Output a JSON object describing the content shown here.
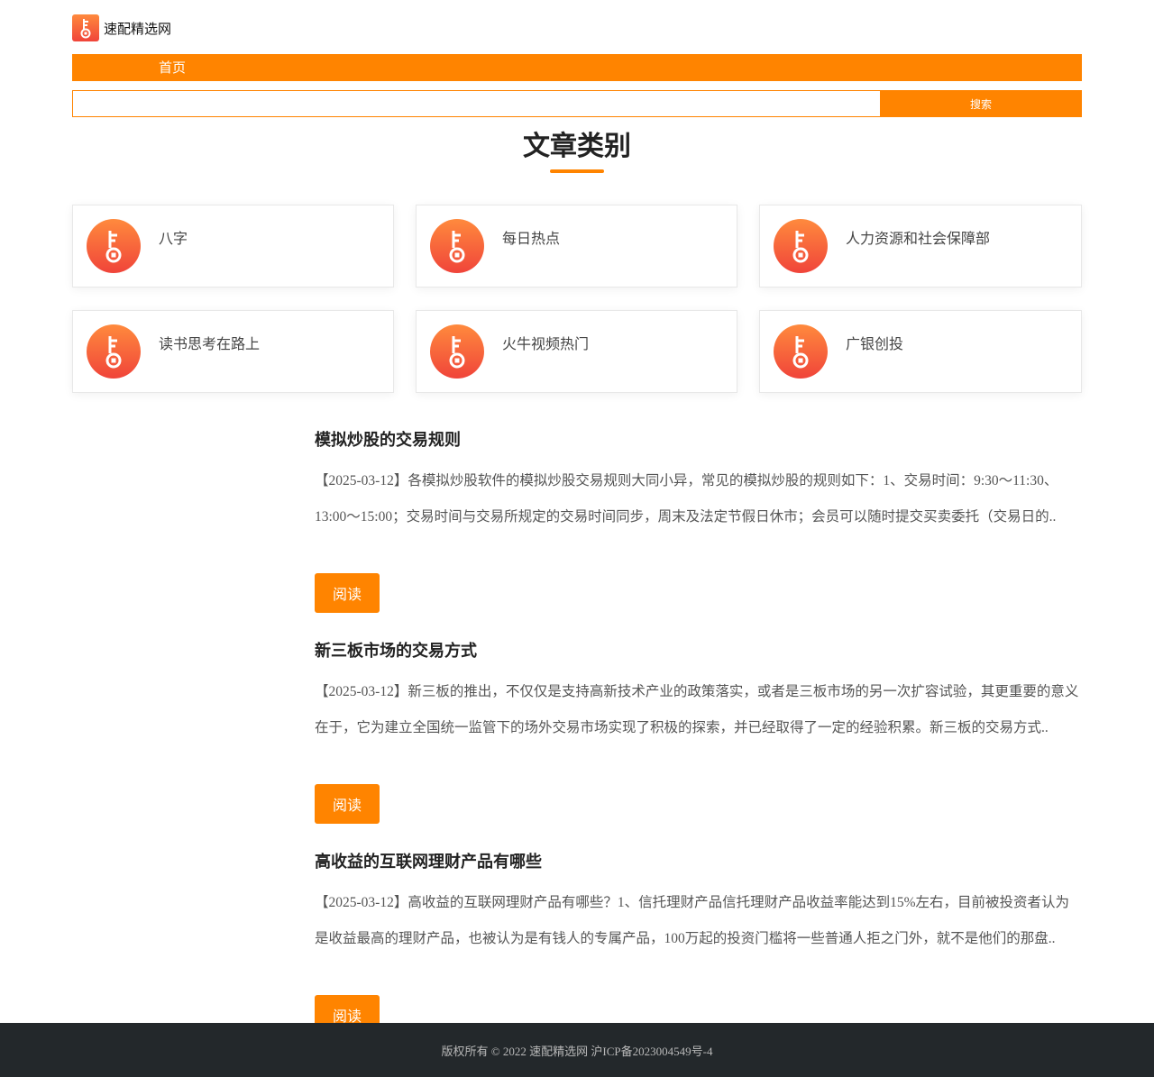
{
  "site": {
    "name": "速配精选网",
    "accent": "#ff8400"
  },
  "nav": {
    "items": [
      {
        "label": "首页"
      }
    ]
  },
  "search": {
    "placeholder": "",
    "value": "",
    "button_label": "搜索"
  },
  "categories_section": {
    "title": "文章类别",
    "items": [
      {
        "label": "八字",
        "icon": "key-icon"
      },
      {
        "label": "每日热点",
        "icon": "key-icon"
      },
      {
        "label": "人力资源和社会保障部",
        "icon": "key-icon"
      },
      {
        "label": "读书思考在路上",
        "icon": "key-icon"
      },
      {
        "label": "火牛视频热门",
        "icon": "key-icon"
      },
      {
        "label": "广银创投",
        "icon": "key-icon"
      }
    ]
  },
  "articles": [
    {
      "title": "模拟炒股的交易规则",
      "excerpt": "【2025-03-12】各模拟炒股软件的模拟炒股交易规则大同小异，常见的模拟炒股的规则如下：1、交易时间：9:30～11:30、13:00～15:00；交易时间与交易所规定的交易时间同步，周末及法定节假日休市；会员可以随时提交买卖委托（交易日的..",
      "button_label": "阅读"
    },
    {
      "title": "新三板市场的交易方式",
      "excerpt": "【2025-03-12】新三板的推出，不仅仅是支持高新技术产业的政策落实，或者是三板市场的另一次扩容试验，其更重要的意义在于，它为建立全国统一监管下的场外交易市场实现了积极的探索，并已经取得了一定的经验积累。新三板的交易方式..",
      "button_label": "阅读"
    },
    {
      "title": "高收益的互联网理财产品有哪些",
      "excerpt": "【2025-03-12】高收益的互联网理财产品有哪些？1、信托理财产品信托理财产品收益率能达到15%左右，目前被投资者认为是收益最高的理财产品，也被认为是有钱人的专属产品，100万起的投资门槛将一些普通人拒之门外，就不是他们的那盘..",
      "button_label": "阅读"
    }
  ],
  "footer": {
    "text": "版权所有 © 2022 速配精选网   沪ICP备2023004549号-4"
  }
}
